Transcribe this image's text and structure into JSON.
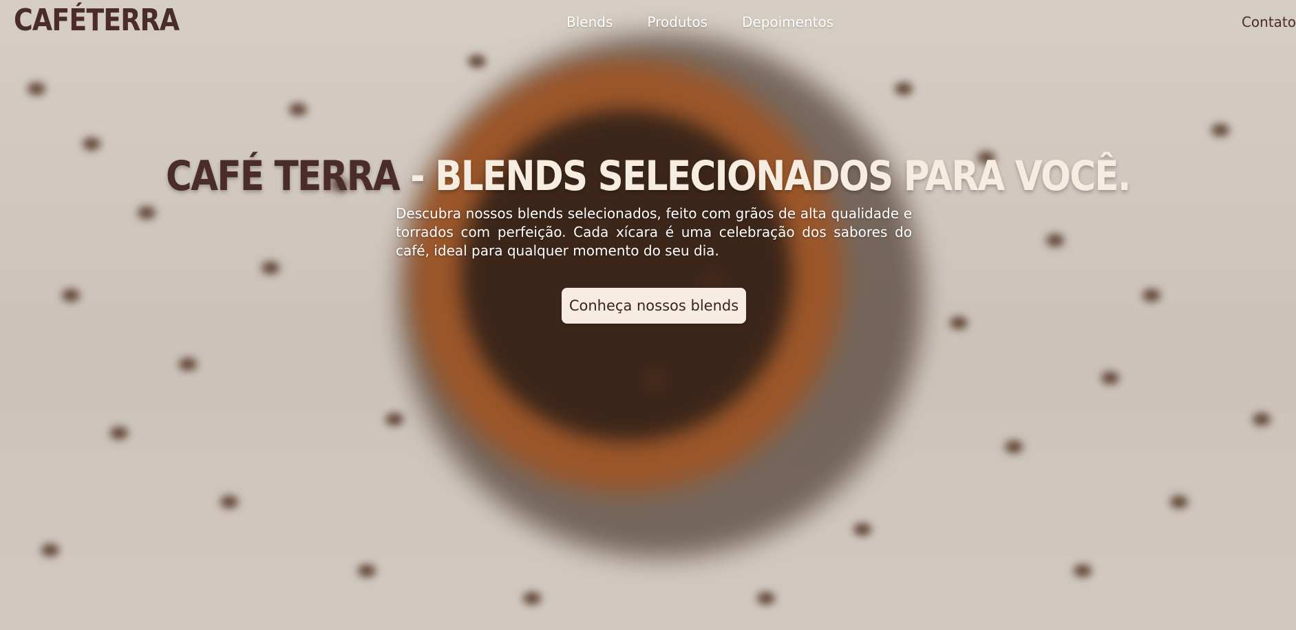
{
  "header": {
    "logo": "CAFÉTERRA",
    "nav": [
      "Blends",
      "Produtos",
      "Depoimentos"
    ],
    "contact": "Contato"
  },
  "hero": {
    "title_brand": "CAFÉ TERRA",
    "title_rest": " - BLENDS SELECIONADOS PARA VOCÊ.",
    "description": "Descubra nossos blends selecionados, feito com grãos de alta qualidade e torrados com perfeição. Cada xícara é uma celebração dos sabores do café, ideal para qualquer momento do seu dia.",
    "cta_label": "Conheça nossos blends"
  },
  "colors": {
    "brand_brown": "#4a2c2a",
    "cream": "#f6ece0"
  }
}
